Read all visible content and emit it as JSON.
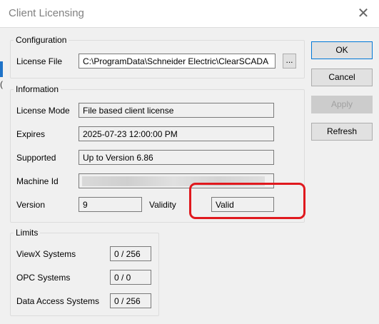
{
  "window": {
    "title": "Client Licensing",
    "close_glyph": "✕"
  },
  "edge": {
    "glyph": "("
  },
  "configuration": {
    "legend": "Configuration",
    "license_file_label": "License File",
    "license_file_value": "C:\\ProgramData\\Schneider Electric\\ClearSCADA",
    "browse_label": "..."
  },
  "information": {
    "legend": "Information",
    "license_mode_label": "License Mode",
    "license_mode_value": "File based client license",
    "expires_label": "Expires",
    "expires_value": "2025-07-23 12:00:00 PM",
    "supported_label": "Supported",
    "supported_value": "Up to Version 6.86",
    "machine_id_label": "Machine Id",
    "version_label": "Version",
    "version_value": "9",
    "validity_label": "Validity",
    "validity_value": "Valid"
  },
  "limits": {
    "legend": "Limits",
    "viewx_label": "ViewX Systems",
    "viewx_value": "0 / 256",
    "opc_label": "OPC Systems",
    "opc_value": "0 / 0",
    "data_access_label": "Data Access Systems",
    "data_access_value": "0 / 256"
  },
  "buttons": {
    "ok": "OK",
    "cancel": "Cancel",
    "apply": "Apply",
    "refresh": "Refresh"
  },
  "colors": {
    "highlight": "#e0191e",
    "primary_border": "#0078d7"
  },
  "icons": {
    "close": "close-icon"
  }
}
